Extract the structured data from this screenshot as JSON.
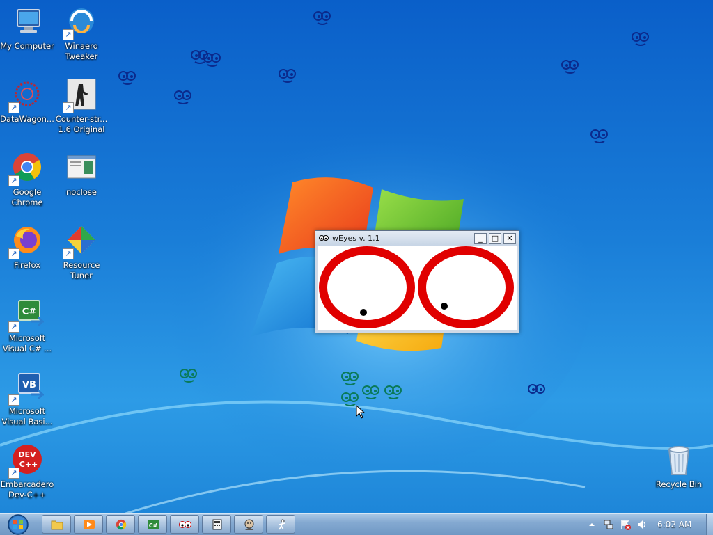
{
  "desktop": {
    "icons": [
      {
        "label": "My Computer",
        "icon": "computer-icon"
      },
      {
        "label": "Winaero\nTweaker",
        "icon": "winaero-icon"
      },
      {
        "label": "DataWagon...",
        "icon": "datawagon-icon"
      },
      {
        "label": "Counter-str...\n1.6 Original",
        "icon": "counter-strike-icon"
      },
      {
        "label": "Google\nChrome",
        "icon": "chrome-icon"
      },
      {
        "label": "noclose",
        "icon": "noclose-icon"
      },
      {
        "label": "Firefox",
        "icon": "firefox-icon"
      },
      {
        "label": "Resource\nTuner",
        "icon": "resource-tuner-icon"
      },
      {
        "label": "Microsoft\nVisual C# ...",
        "icon": "visual-csharp-icon"
      },
      {
        "label": "Microsoft\nVisual Basi...",
        "icon": "visual-basic-icon"
      },
      {
        "label": "Embarcadero\nDev-C++",
        "icon": "dev-cpp-icon"
      },
      {
        "label": "Recycle Bin",
        "icon": "recycle-bin-icon"
      }
    ],
    "dev_cpp_badge": "DEV\nC++"
  },
  "window": {
    "title": "wEyes v. 1.1",
    "minimize_label": "_",
    "maximize_label": "□",
    "close_label": "✕",
    "eye_color": "#e00000"
  },
  "taskbar": {
    "pinned": [
      {
        "name": "explorer",
        "icon": "folder-icon"
      },
      {
        "name": "media-player",
        "icon": "media-player-icon"
      },
      {
        "name": "chrome",
        "icon": "chrome-icon"
      },
      {
        "name": "visual-csharp",
        "icon": "visual-csharp-icon"
      },
      {
        "name": "weyes",
        "icon": "weyes-icon"
      },
      {
        "name": "calculator",
        "icon": "calculator-icon"
      },
      {
        "name": "face",
        "icon": "face-icon"
      },
      {
        "name": "stick-figure",
        "icon": "stick-figure-icon"
      }
    ],
    "clock": "6:02 AM",
    "tray_icons": [
      "show-hidden-icon",
      "network-icon",
      "action-center-icon",
      "volume-icon"
    ]
  },
  "colors": {
    "desktop_blue": "#1a7ed8",
    "taskbar": "#84a9d1",
    "eye_ring": "#e00000"
  }
}
